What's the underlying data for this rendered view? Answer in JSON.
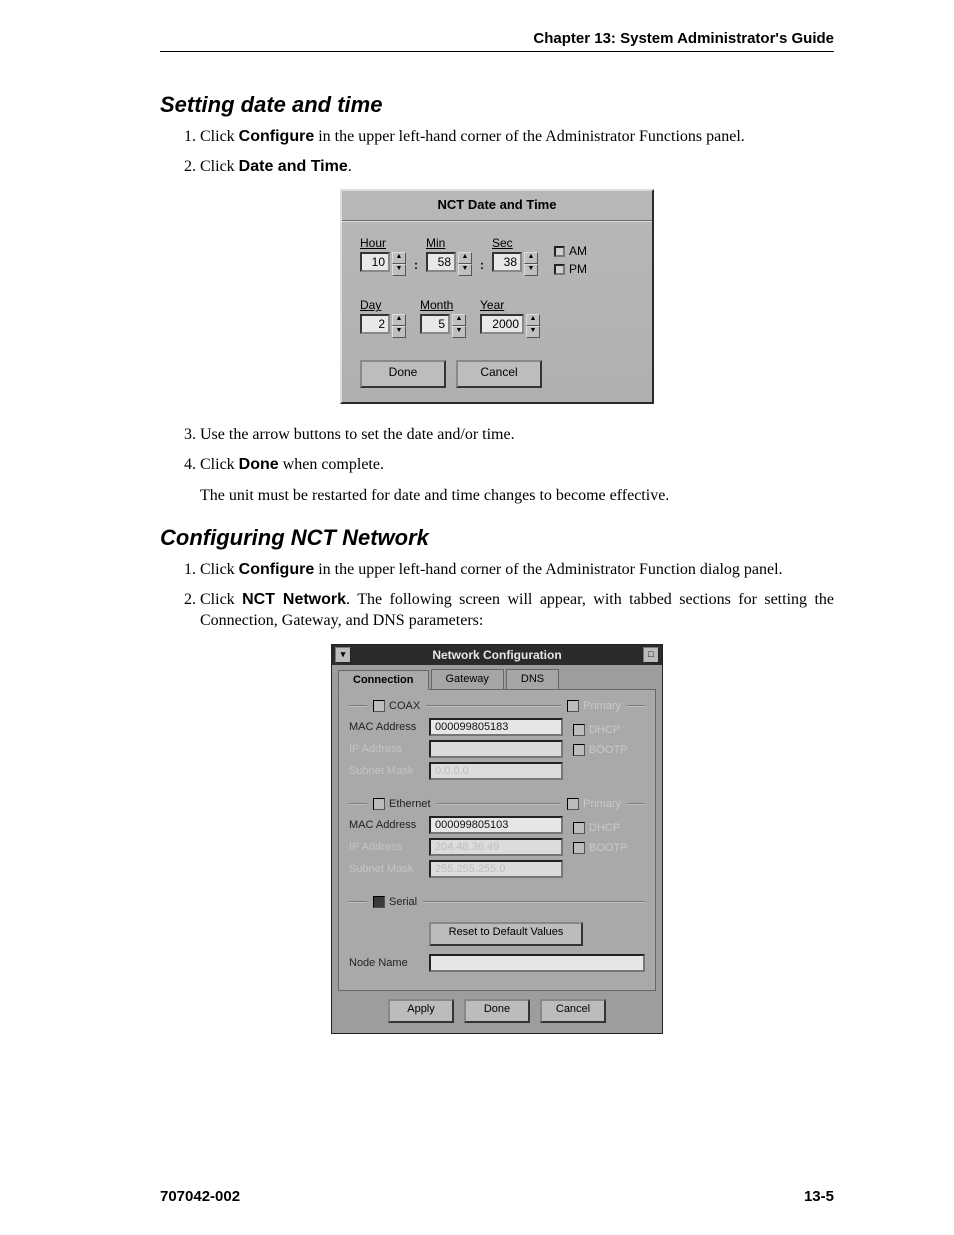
{
  "header": {
    "chapter": "Chapter 13: System Administrator's Guide"
  },
  "section1": {
    "title": "Setting date and time",
    "step1_pre": "Click ",
    "step1_bold": "Configure",
    "step1_post": " in the upper left-hand corner of the Administrator Functions panel.",
    "step2_pre": "Click ",
    "step2_bold": "Date and Time",
    "step2_post": ".",
    "step3": "Use the arrow buttons to set the date and/or time.",
    "step4_pre": "Click ",
    "step4_bold": "Done",
    "step4_post": " when complete.",
    "note": "The unit must be restarted for date and time changes to become effective."
  },
  "dt": {
    "title": "NCT Date and Time",
    "hourLabel": "Hour",
    "minLabel": "Min",
    "secLabel": "Sec",
    "hour": "10",
    "min": "58",
    "sec": "38",
    "am": "AM",
    "pm": "PM",
    "dayLabel": "Day",
    "monthLabel": "Month",
    "yearLabel": "Year",
    "day": "2",
    "month": "5",
    "year": "2000",
    "done": "Done",
    "cancel": "Cancel"
  },
  "section2": {
    "title": "Configuring NCT Network",
    "step1_pre": "Click ",
    "step1_bold": "Configure",
    "step1_post": " in the upper left-hand corner of the Administrator Function dialog panel.",
    "step2_pre": "Click ",
    "step2_bold": "NCT Network",
    "step2_post": ". The following screen will appear, with tabbed sections for setting the Connection, Gateway, and DNS parameters:"
  },
  "nc": {
    "title": "Network Configuration",
    "tabs": {
      "connection": "Connection",
      "gateway": "Gateway",
      "dns": "DNS"
    },
    "coax": {
      "groupLabel": "COAX",
      "primary": "Primary",
      "macLabel": "MAC Address",
      "mac": "000099805183",
      "ipLabel": "IP Address",
      "ip": "",
      "subnetLabel": "Subnet Mask",
      "subnet": "0.0.0.0",
      "dhcp": "DHCP",
      "bootp": "BOOTP"
    },
    "eth": {
      "groupLabel": "Ethernet",
      "primary": "Primary",
      "macLabel": "MAC Address",
      "mac": "000099805103",
      "ipLabel": "IP Address",
      "ip": "204.48.36.49",
      "subnetLabel": "Subnet Mask",
      "subnet": "255.255.255.0",
      "dhcp": "DHCP",
      "bootp": "BOOTP"
    },
    "serial": "Serial",
    "reset": "Reset to Default Values",
    "nodeName": "Node Name",
    "nodeValue": "",
    "apply": "Apply",
    "done": "Done",
    "cancel": "Cancel"
  },
  "footer": {
    "left": "707042-002",
    "right": "13-5"
  }
}
